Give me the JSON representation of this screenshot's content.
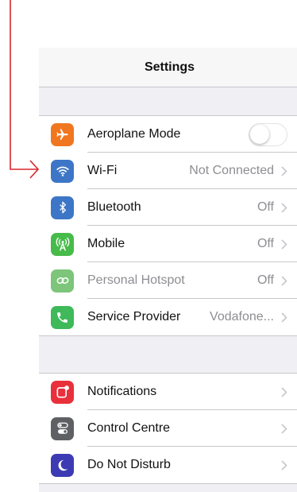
{
  "header": {
    "title": "Settings"
  },
  "connectivity": [
    {
      "label": "Aeroplane Mode",
      "value": "",
      "color": "#f0771f",
      "icon": "airplane-icon",
      "toggle": "off"
    },
    {
      "label": "Wi-Fi",
      "value": "Not Connected",
      "color": "#3e76c7",
      "icon": "wifi-icon"
    },
    {
      "label": "Bluetooth",
      "value": "Off",
      "color": "#3e76c7",
      "icon": "bluetooth-icon"
    },
    {
      "label": "Mobile",
      "value": "Off",
      "color": "#47bb4a",
      "icon": "antenna-icon"
    },
    {
      "label": "Personal Hotspot",
      "value": "Off",
      "color": "#7cc57b",
      "icon": "hotspot-icon",
      "dimmed": true
    },
    {
      "label": "Service Provider",
      "value": "Vodafone...",
      "color": "#3fb95a",
      "icon": "phone-icon"
    }
  ],
  "system": [
    {
      "label": "Notifications",
      "color": "#e8313b",
      "icon": "notifications-icon"
    },
    {
      "label": "Control Centre",
      "color": "#5f6063",
      "icon": "control-centre-icon"
    },
    {
      "label": "Do Not Disturb",
      "color": "#3d3bb3",
      "icon": "moon-icon"
    }
  ],
  "annotation": {
    "arrow_color": "#d9252b"
  }
}
